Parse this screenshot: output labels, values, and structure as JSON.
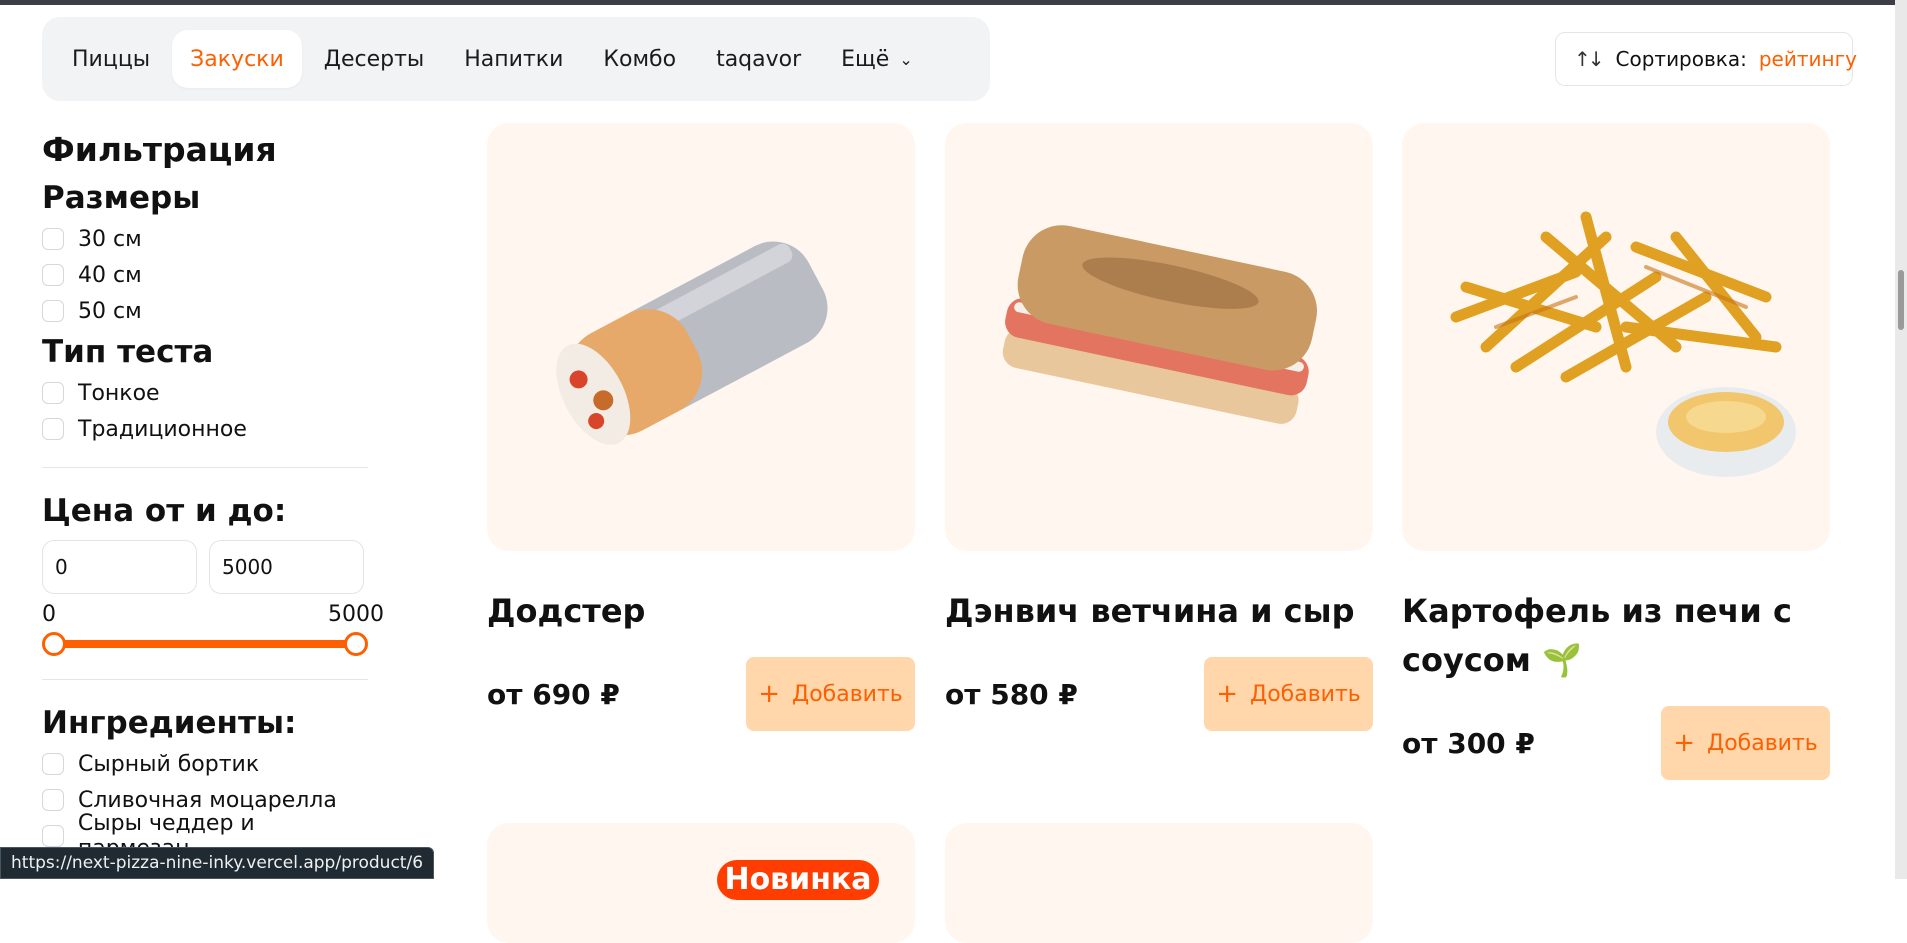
{
  "nav": {
    "categories": [
      "Пиццы",
      "Закуски",
      "Десерты",
      "Напитки",
      "Комбо",
      "taqavor"
    ],
    "active_category": "Закуски",
    "more_label": "Ещё"
  },
  "sort": {
    "label": "Сортировка:",
    "value": "рейтингу",
    "icon": "sort-arrows-icon"
  },
  "filters": {
    "title": "Фильтрация",
    "sizes": {
      "title": "Размеры",
      "options": [
        "30 см",
        "40 см",
        "50 см"
      ]
    },
    "dough": {
      "title": "Тип теста",
      "options": [
        "Тонкое",
        "Традиционное"
      ]
    },
    "price": {
      "title": "Цена от и до:",
      "from_value": "0",
      "to_value": "5000",
      "min_label": "0",
      "max_label": "5000",
      "range_from": 0,
      "range_to": 1
    },
    "ingredients": {
      "title": "Ингредиенты:",
      "options": [
        "Сырный бортик",
        "Сливочная моцарелла",
        "Сыры чеддер и пармезан"
      ]
    }
  },
  "products": [
    {
      "title": "Додстер",
      "price": "от 690 ₽",
      "add_label": "Добавить",
      "image": "wrap-image"
    },
    {
      "title": "Дэнвич ветчина и сыр",
      "price": "от 580 ₽",
      "add_label": "Добавить",
      "image": "sandwich-image"
    },
    {
      "title": "Картофель из печи с соусом 🌱",
      "price": "от 300 ₽",
      "add_label": "Добавить",
      "image": "fries-image"
    }
  ],
  "partial_badge": "Новинка",
  "status_url": "https://next-pizza-nine-inky.vercel.app/product/6",
  "colors": {
    "accent": "#fe5f00",
    "card_bg": "#fff7ef",
    "button_bg": "#ffd7ab",
    "nav_bg": "#f2f3f5"
  }
}
